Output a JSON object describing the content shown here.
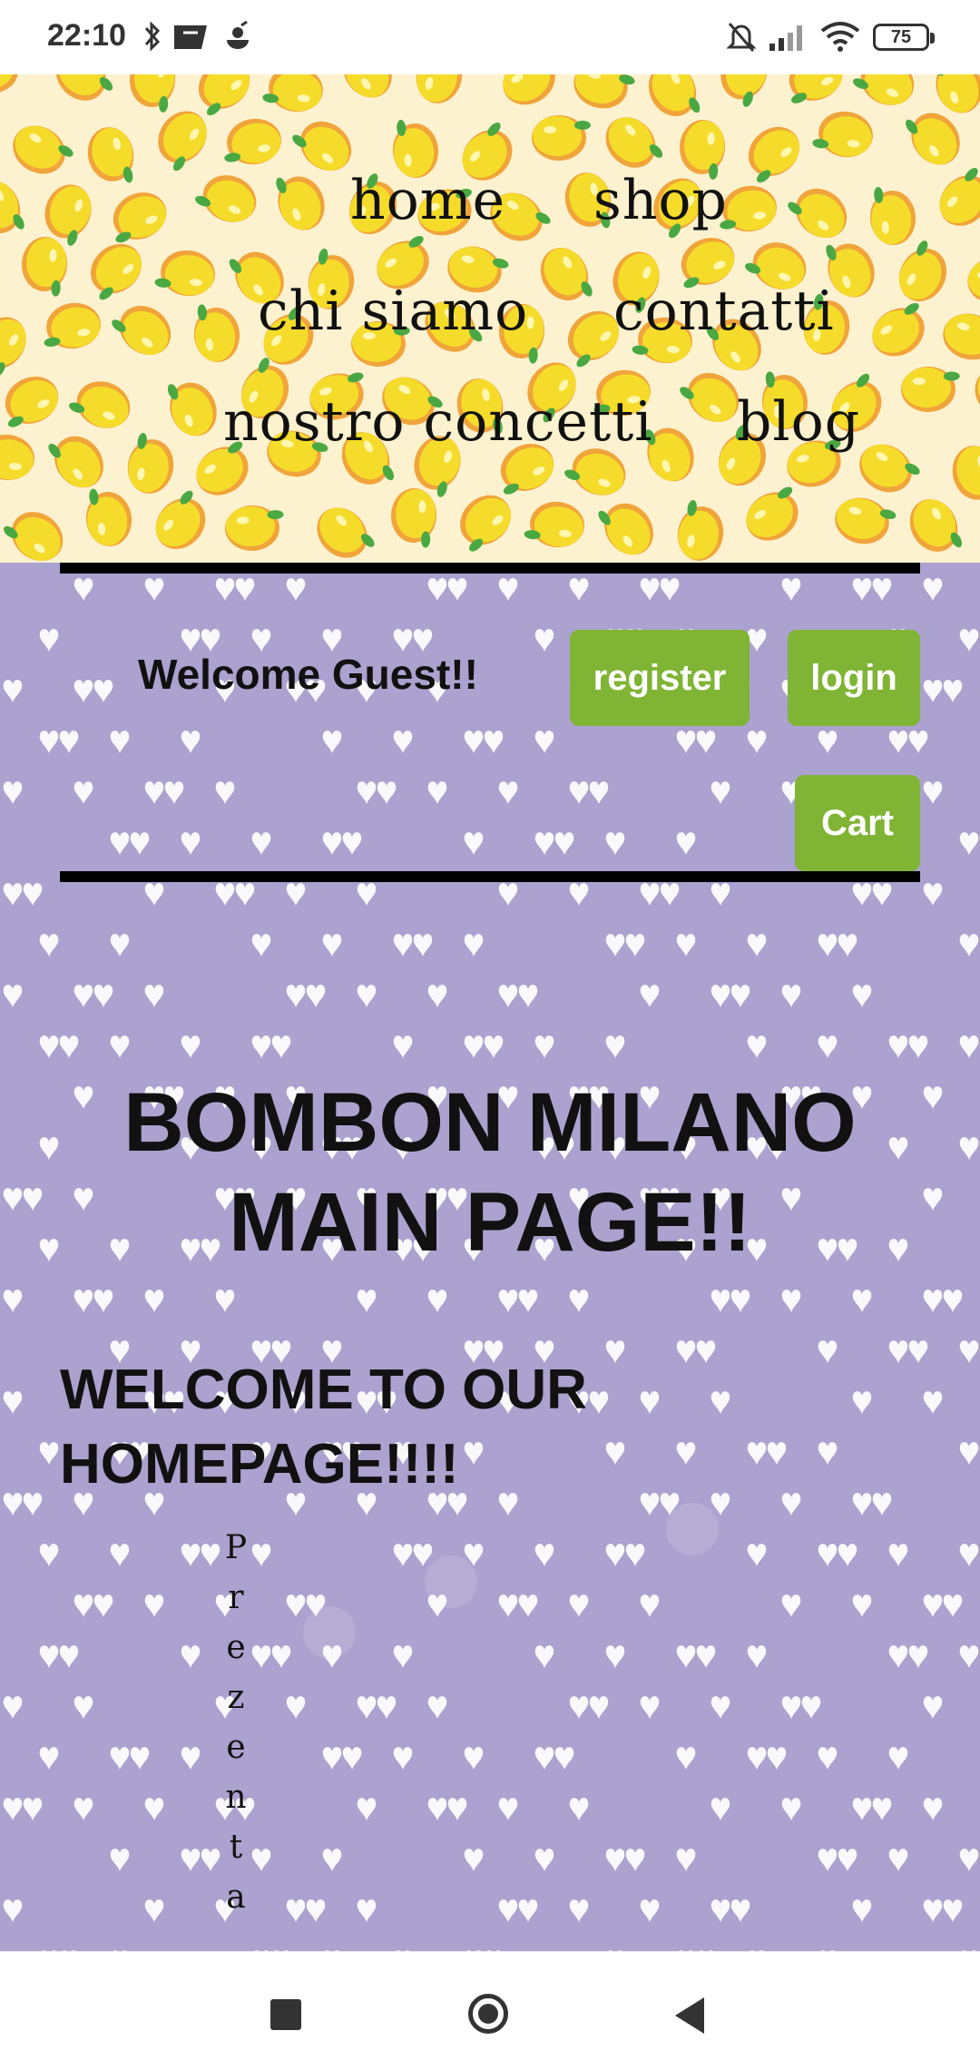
{
  "status_bar": {
    "time": "22:10",
    "battery": "75",
    "icons": [
      "bluetooth-icon",
      "app-icon",
      "cloud-icon",
      "mute-bell-icon",
      "signal-icon",
      "wifi-icon",
      "battery-icon"
    ]
  },
  "nav": {
    "items": [
      {
        "label": "home"
      },
      {
        "label": "shop"
      },
      {
        "label": "chi siamo"
      },
      {
        "label": "contatti"
      },
      {
        "label": "nostro concetti"
      },
      {
        "label": "blog"
      }
    ]
  },
  "user_bar": {
    "welcome": "Welcome Guest!!",
    "register_label": "register",
    "login_label": "login",
    "cart_label": "Cart"
  },
  "main": {
    "title_line1": "BOMBON MILANO",
    "title_line2": "MAIN PAGE!!",
    "welcome_line1": "WELCOME TO OUR",
    "welcome_line2": "HOMEPAGE!!!!",
    "vertical_letters": [
      "P",
      "r",
      "e",
      "z",
      "e",
      "n",
      "t",
      "a"
    ]
  },
  "colors": {
    "header_bg": "#fdf2cf",
    "lemon": "#f6dc2a",
    "purple_bg": "#aba2cf",
    "button_green": "#80b434"
  }
}
